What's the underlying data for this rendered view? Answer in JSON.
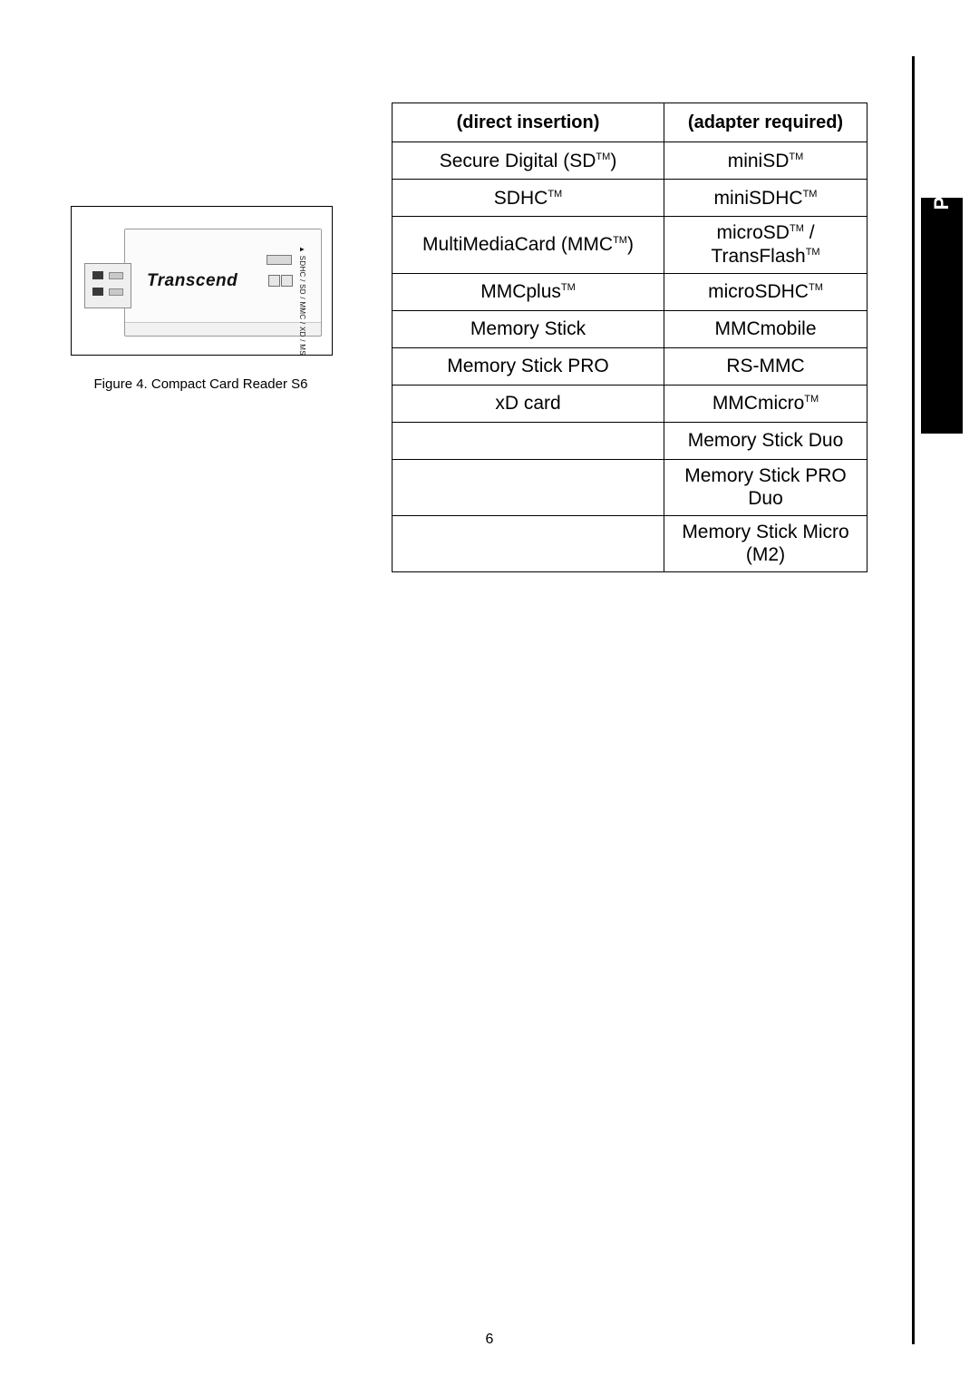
{
  "sidebar": {
    "tab_label": "Product Overview"
  },
  "figure": {
    "brand": "Transcend",
    "slot_label": "▲ SDHC / SD / MMC / XD / MS",
    "caption": "Figure 4. Compact Card Reader S6"
  },
  "table": {
    "headers": {
      "col1": "(direct insertion)",
      "col2": "(adapter required)"
    },
    "rows": [
      {
        "direct": "Secure Digital (SD",
        "direct_tm": true,
        "direct_tail": ")",
        "adapter": "miniSD",
        "adapter_tm": true,
        "adapter_tail": ""
      },
      {
        "direct": "SDHC",
        "direct_tm": true,
        "direct_tail": "",
        "adapter": "miniSDHC",
        "adapter_tm": true,
        "adapter_tail": ""
      },
      {
        "direct": "MultiMediaCard (MMC",
        "direct_tm": true,
        "direct_tail": ")",
        "adapter": "microSD",
        "adapter_tm": true,
        "adapter_tail": " / TransFlash",
        "adapter_tm2": true
      },
      {
        "direct": "MMCplus",
        "direct_tm": true,
        "direct_tail": "",
        "adapter": "microSDHC",
        "adapter_tm": true,
        "adapter_tail": ""
      },
      {
        "direct": "Memory Stick",
        "direct_tm": false,
        "direct_tail": "",
        "adapter": "MMCmobile",
        "adapter_tm": false,
        "adapter_tail": ""
      },
      {
        "direct": "Memory Stick PRO",
        "direct_tm": false,
        "direct_tail": "",
        "adapter": "RS-MMC",
        "adapter_tm": false,
        "adapter_tail": "",
        "adapter_bold": true
      },
      {
        "direct": "xD card",
        "direct_tm": false,
        "direct_tail": "",
        "adapter": "MMCmicro",
        "adapter_tm": true,
        "adapter_tail": ""
      },
      {
        "direct": "",
        "direct_tm": false,
        "direct_tail": "",
        "adapter": "Memory Stick Duo",
        "adapter_tm": false,
        "adapter_tail": ""
      },
      {
        "direct": "",
        "direct_tm": false,
        "direct_tail": "",
        "adapter": "Memory Stick PRO Duo",
        "adapter_tm": false,
        "adapter_tail": ""
      },
      {
        "direct": "",
        "direct_tm": false,
        "direct_tail": "",
        "adapter": "Memory Stick Micro (M2)",
        "adapter_tm": false,
        "adapter_tail": ""
      }
    ]
  },
  "footer": {
    "page_number": "6"
  }
}
